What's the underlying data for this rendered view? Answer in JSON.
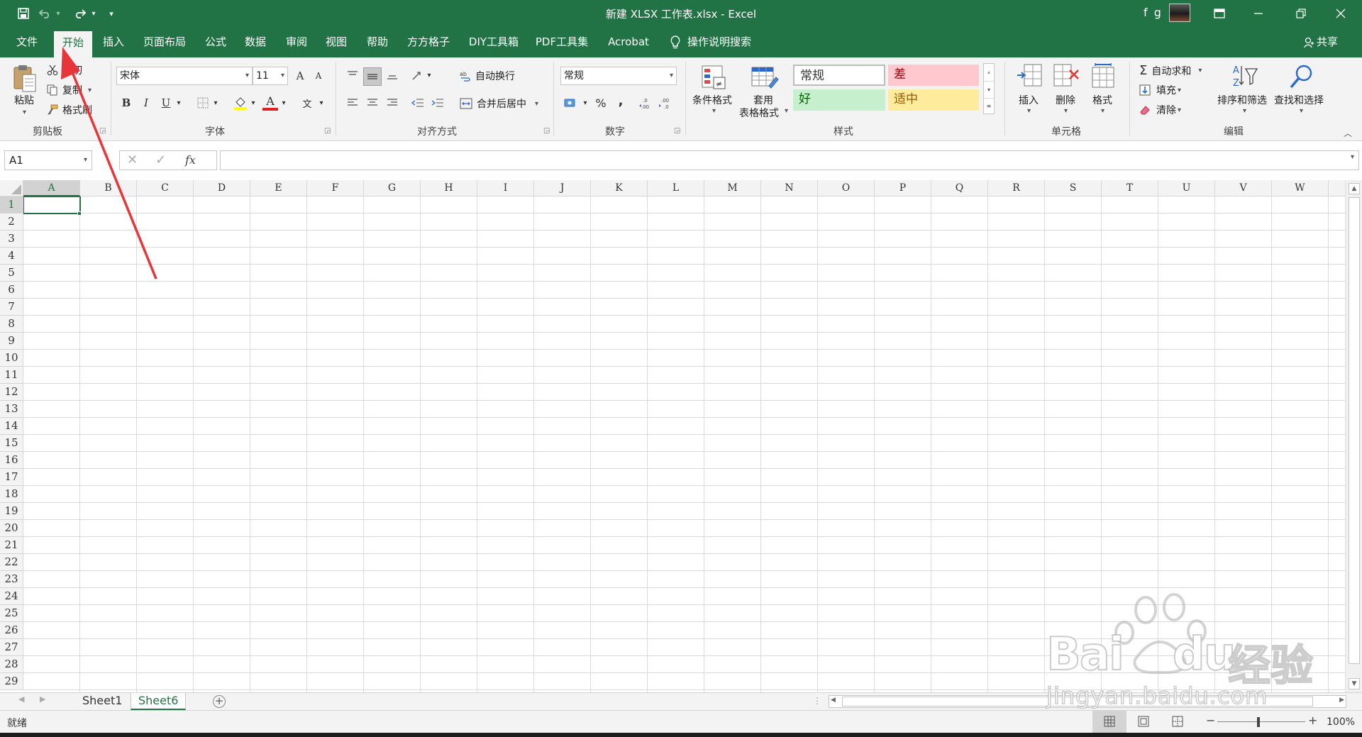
{
  "window": {
    "title": "新建 XLSX 工作表.xlsx  -  Excel",
    "user": "f g",
    "qat_customize": "▾"
  },
  "tabs": [
    {
      "label": "文件"
    },
    {
      "label": "开始"
    },
    {
      "label": "插入"
    },
    {
      "label": "页面布局"
    },
    {
      "label": "公式"
    },
    {
      "label": "数据"
    },
    {
      "label": "审阅"
    },
    {
      "label": "视图"
    },
    {
      "label": "帮助"
    },
    {
      "label": "方方格子"
    },
    {
      "label": "DIY工具箱"
    },
    {
      "label": "PDF工具集"
    },
    {
      "label": "Acrobat"
    }
  ],
  "active_tab": "开始",
  "tell_me": "操作说明搜索",
  "share": "共享",
  "ribbon": {
    "clipboard": {
      "paste": "粘贴",
      "cut": "剪切",
      "copy": "复制",
      "format_painter": "格式刷",
      "label": "剪贴板"
    },
    "font": {
      "name": "宋体",
      "size": "11",
      "grow": "A",
      "shrink": "A",
      "bold": "B",
      "italic": "I",
      "underline": "U",
      "font_color": "A",
      "phonetic": "文",
      "label": "字体"
    },
    "alignment": {
      "wrap": "自动换行",
      "merge": "合并后居中",
      "label": "对齐方式"
    },
    "number": {
      "format": "常规",
      "percent": "%",
      "comma": ",",
      "label": "数字"
    },
    "styles": {
      "conditional": "条件格式",
      "table_a": "套用",
      "table_b": "表格格式",
      "normal": "常规",
      "bad": "差",
      "good": "好",
      "neutral": "适中",
      "label": "样式"
    },
    "cells": {
      "insert": "插入",
      "delete": "删除",
      "format": "格式",
      "label": "单元格"
    },
    "editing": {
      "autosum": "自动求和",
      "fill": "填充",
      "clear": "清除",
      "sort": "排序和筛选",
      "find": "查找和选择",
      "label": "编辑"
    }
  },
  "formula_bar": {
    "name_box": "A1",
    "fx": "fx",
    "value": ""
  },
  "grid": {
    "columns": [
      "A",
      "B",
      "C",
      "D",
      "E",
      "F",
      "G",
      "H",
      "I",
      "J",
      "K",
      "L",
      "M",
      "N",
      "O",
      "P",
      "Q",
      "R",
      "S",
      "T",
      "U",
      "V",
      "W"
    ],
    "rows": [
      "1",
      "2",
      "3",
      "4",
      "5",
      "6",
      "7",
      "8",
      "9",
      "10",
      "11",
      "12",
      "13",
      "14",
      "15",
      "16",
      "17",
      "18",
      "19",
      "20",
      "21",
      "22",
      "23",
      "24",
      "25",
      "26",
      "27",
      "28",
      "29"
    ],
    "selected": "A1"
  },
  "sheets": [
    "Sheet1",
    "Sheet6"
  ],
  "active_sheet": "Sheet6",
  "status": {
    "text": "就绪",
    "zoom": "100%",
    "zoom_minus": "−",
    "zoom_plus": "+"
  },
  "watermark": {
    "brand": "Bai",
    "brand2": "du",
    "cn": "经验",
    "url": "jingyan.baidu.com"
  },
  "colors": {
    "accent": "#217346",
    "annotation": "#e8353a"
  }
}
